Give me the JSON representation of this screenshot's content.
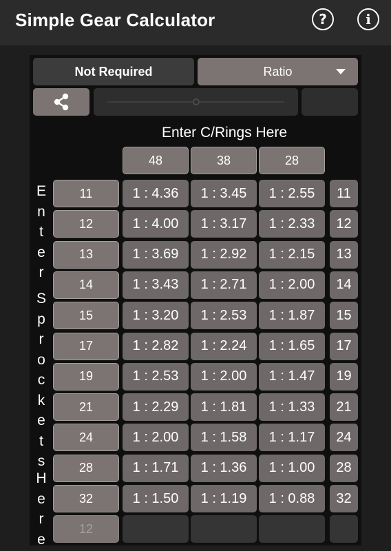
{
  "app": {
    "title": "Simple Gear Calculator",
    "help_icon": "help-circle-icon",
    "info_icon": "info-circle-icon"
  },
  "controls": {
    "mode_left_label": "Not Required",
    "mode_right_label": "Ratio",
    "share_icon": "share-icon",
    "slider_position": 0.5
  },
  "chainrings": {
    "title": "Enter C/Rings Here",
    "values": [
      "48",
      "38",
      "28"
    ]
  },
  "sprockets": {
    "side_label": "Enter Sprockets Here",
    "values": [
      "11",
      "12",
      "13",
      "14",
      "15",
      "17",
      "19",
      "21",
      "24",
      "28",
      "32"
    ],
    "empty_placeholder": "12"
  },
  "ratios": [
    [
      "1 : 4.36",
      "1 : 3.45",
      "1 : 2.55"
    ],
    [
      "1 : 4.00",
      "1 : 3.17",
      "1 : 2.33"
    ],
    [
      "1 : 3.69",
      "1 : 2.92",
      "1 : 2.15"
    ],
    [
      "1 : 3.43",
      "1 : 2.71",
      "1 : 2.00"
    ],
    [
      "1 : 3.20",
      "1 : 2.53",
      "1 : 1.87"
    ],
    [
      "1 : 2.82",
      "1 : 2.24",
      "1 : 1.65"
    ],
    [
      "1 : 2.53",
      "1 : 2.00",
      "1 : 1.47"
    ],
    [
      "1 : 2.29",
      "1 : 1.81",
      "1 : 1.33"
    ],
    [
      "1 : 2.00",
      "1 : 1.58",
      "1 : 1.17"
    ],
    [
      "1 : 1.71",
      "1 : 1.36",
      "1 : 1.00"
    ],
    [
      "1 : 1.50",
      "1 : 1.19",
      "1 : 0.88"
    ]
  ],
  "colors": {
    "app_bar": "#2b2b2b",
    "background": "#1e1e1e",
    "input_cell": "#7c7373",
    "ratio_cell": "#6e6868",
    "selected_mode": "#3c3c3c"
  }
}
